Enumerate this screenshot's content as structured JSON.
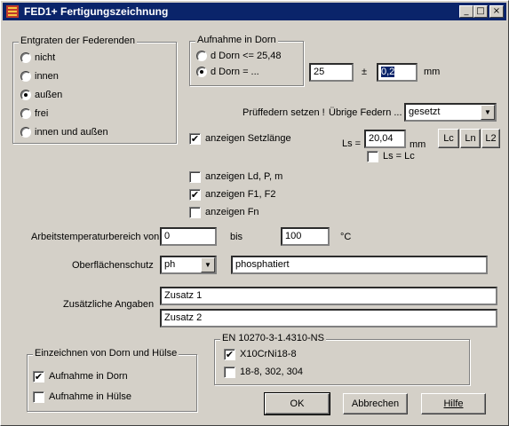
{
  "window": {
    "title": "FED1+ Fertigungszeichnung",
    "controls": {
      "minimize": "_",
      "maximize": "□",
      "close": "×"
    }
  },
  "entgraten": {
    "legend": "Entgraten der Federenden",
    "options": [
      "nicht",
      "innen",
      "außen",
      "frei",
      "innen und außen"
    ],
    "selected": "außen"
  },
  "aufnahme_dorn": {
    "legend": "Aufnahme in Dorn",
    "options": [
      "d Dorn <= 25,48",
      "d Dorn = ..."
    ],
    "selected": "d Dorn = ...",
    "value": "25",
    "pm_label": "±",
    "tolerance": "0,2",
    "unit": "mm"
  },
  "pruef": {
    "label": "Prüffedern setzen !",
    "other_label": "Übrige Federn ...",
    "select_value": "gesetzt"
  },
  "setzlaenge": {
    "label": "anzeigen Setzlänge",
    "checked": true,
    "ls_label": "Ls =",
    "ls_value": "20,04",
    "unit": "mm",
    "ls_eq_lc_label": "Ls = Lc",
    "ls_eq_lc_checked": false,
    "buttons": [
      "Lc",
      "Ln",
      "L2"
    ]
  },
  "anzeigen": [
    {
      "label": "anzeigen Ld, P, m",
      "checked": false
    },
    {
      "label": "anzeigen F1, F2",
      "checked": true
    },
    {
      "label": "anzeigen Fn",
      "checked": false
    }
  ],
  "temperatur": {
    "label": "Arbeitstemperaturbereich von",
    "from": "0",
    "bis_label": "bis",
    "to": "100",
    "unit": "°C"
  },
  "oberflaeche": {
    "label": "Oberflächenschutz",
    "code": "ph",
    "text": "phosphatiert"
  },
  "zusaetzlich": {
    "label": "Zusätzliche Angaben",
    "line1": "Zusatz 1",
    "line2": "Zusatz 2"
  },
  "einzeichnen": {
    "legend": "Einzeichnen von Dorn und Hülse",
    "options": [
      {
        "label": "Aufnahme in Dorn",
        "checked": true
      },
      {
        "label": "Aufnahme in Hülse",
        "checked": false
      }
    ]
  },
  "werkstoff": {
    "legend": "EN 10270-3-1.4310-NS",
    "options": [
      {
        "label": "X10CrNi18-8",
        "checked": true
      },
      {
        "label": "18-8, 302, 304",
        "checked": false
      }
    ]
  },
  "buttons": {
    "ok": "OK",
    "cancel": "Abbrechen",
    "help": "Hilfe"
  }
}
